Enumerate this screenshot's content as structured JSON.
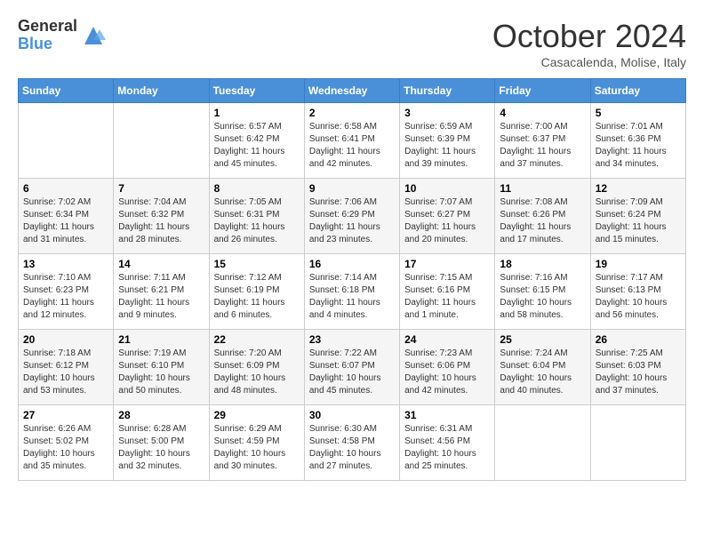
{
  "logo": {
    "general": "General",
    "blue": "Blue"
  },
  "title": "October 2024",
  "subtitle": "Casacalenda, Molise, Italy",
  "days_header": [
    "Sunday",
    "Monday",
    "Tuesday",
    "Wednesday",
    "Thursday",
    "Friday",
    "Saturday"
  ],
  "weeks": [
    [
      {
        "day": "",
        "sunrise": "",
        "sunset": "",
        "daylight": ""
      },
      {
        "day": "",
        "sunrise": "",
        "sunset": "",
        "daylight": ""
      },
      {
        "day": "1",
        "sunrise": "Sunrise: 6:57 AM",
        "sunset": "Sunset: 6:42 PM",
        "daylight": "Daylight: 11 hours and 45 minutes."
      },
      {
        "day": "2",
        "sunrise": "Sunrise: 6:58 AM",
        "sunset": "Sunset: 6:41 PM",
        "daylight": "Daylight: 11 hours and 42 minutes."
      },
      {
        "day": "3",
        "sunrise": "Sunrise: 6:59 AM",
        "sunset": "Sunset: 6:39 PM",
        "daylight": "Daylight: 11 hours and 39 minutes."
      },
      {
        "day": "4",
        "sunrise": "Sunrise: 7:00 AM",
        "sunset": "Sunset: 6:37 PM",
        "daylight": "Daylight: 11 hours and 37 minutes."
      },
      {
        "day": "5",
        "sunrise": "Sunrise: 7:01 AM",
        "sunset": "Sunset: 6:36 PM",
        "daylight": "Daylight: 11 hours and 34 minutes."
      }
    ],
    [
      {
        "day": "6",
        "sunrise": "Sunrise: 7:02 AM",
        "sunset": "Sunset: 6:34 PM",
        "daylight": "Daylight: 11 hours and 31 minutes."
      },
      {
        "day": "7",
        "sunrise": "Sunrise: 7:04 AM",
        "sunset": "Sunset: 6:32 PM",
        "daylight": "Daylight: 11 hours and 28 minutes."
      },
      {
        "day": "8",
        "sunrise": "Sunrise: 7:05 AM",
        "sunset": "Sunset: 6:31 PM",
        "daylight": "Daylight: 11 hours and 26 minutes."
      },
      {
        "day": "9",
        "sunrise": "Sunrise: 7:06 AM",
        "sunset": "Sunset: 6:29 PM",
        "daylight": "Daylight: 11 hours and 23 minutes."
      },
      {
        "day": "10",
        "sunrise": "Sunrise: 7:07 AM",
        "sunset": "Sunset: 6:27 PM",
        "daylight": "Daylight: 11 hours and 20 minutes."
      },
      {
        "day": "11",
        "sunrise": "Sunrise: 7:08 AM",
        "sunset": "Sunset: 6:26 PM",
        "daylight": "Daylight: 11 hours and 17 minutes."
      },
      {
        "day": "12",
        "sunrise": "Sunrise: 7:09 AM",
        "sunset": "Sunset: 6:24 PM",
        "daylight": "Daylight: 11 hours and 15 minutes."
      }
    ],
    [
      {
        "day": "13",
        "sunrise": "Sunrise: 7:10 AM",
        "sunset": "Sunset: 6:23 PM",
        "daylight": "Daylight: 11 hours and 12 minutes."
      },
      {
        "day": "14",
        "sunrise": "Sunrise: 7:11 AM",
        "sunset": "Sunset: 6:21 PM",
        "daylight": "Daylight: 11 hours and 9 minutes."
      },
      {
        "day": "15",
        "sunrise": "Sunrise: 7:12 AM",
        "sunset": "Sunset: 6:19 PM",
        "daylight": "Daylight: 11 hours and 6 minutes."
      },
      {
        "day": "16",
        "sunrise": "Sunrise: 7:14 AM",
        "sunset": "Sunset: 6:18 PM",
        "daylight": "Daylight: 11 hours and 4 minutes."
      },
      {
        "day": "17",
        "sunrise": "Sunrise: 7:15 AM",
        "sunset": "Sunset: 6:16 PM",
        "daylight": "Daylight: 11 hours and 1 minute."
      },
      {
        "day": "18",
        "sunrise": "Sunrise: 7:16 AM",
        "sunset": "Sunset: 6:15 PM",
        "daylight": "Daylight: 10 hours and 58 minutes."
      },
      {
        "day": "19",
        "sunrise": "Sunrise: 7:17 AM",
        "sunset": "Sunset: 6:13 PM",
        "daylight": "Daylight: 10 hours and 56 minutes."
      }
    ],
    [
      {
        "day": "20",
        "sunrise": "Sunrise: 7:18 AM",
        "sunset": "Sunset: 6:12 PM",
        "daylight": "Daylight: 10 hours and 53 minutes."
      },
      {
        "day": "21",
        "sunrise": "Sunrise: 7:19 AM",
        "sunset": "Sunset: 6:10 PM",
        "daylight": "Daylight: 10 hours and 50 minutes."
      },
      {
        "day": "22",
        "sunrise": "Sunrise: 7:20 AM",
        "sunset": "Sunset: 6:09 PM",
        "daylight": "Daylight: 10 hours and 48 minutes."
      },
      {
        "day": "23",
        "sunrise": "Sunrise: 7:22 AM",
        "sunset": "Sunset: 6:07 PM",
        "daylight": "Daylight: 10 hours and 45 minutes."
      },
      {
        "day": "24",
        "sunrise": "Sunrise: 7:23 AM",
        "sunset": "Sunset: 6:06 PM",
        "daylight": "Daylight: 10 hours and 42 minutes."
      },
      {
        "day": "25",
        "sunrise": "Sunrise: 7:24 AM",
        "sunset": "Sunset: 6:04 PM",
        "daylight": "Daylight: 10 hours and 40 minutes."
      },
      {
        "day": "26",
        "sunrise": "Sunrise: 7:25 AM",
        "sunset": "Sunset: 6:03 PM",
        "daylight": "Daylight: 10 hours and 37 minutes."
      }
    ],
    [
      {
        "day": "27",
        "sunrise": "Sunrise: 6:26 AM",
        "sunset": "Sunset: 5:02 PM",
        "daylight": "Daylight: 10 hours and 35 minutes."
      },
      {
        "day": "28",
        "sunrise": "Sunrise: 6:28 AM",
        "sunset": "Sunset: 5:00 PM",
        "daylight": "Daylight: 10 hours and 32 minutes."
      },
      {
        "day": "29",
        "sunrise": "Sunrise: 6:29 AM",
        "sunset": "Sunset: 4:59 PM",
        "daylight": "Daylight: 10 hours and 30 minutes."
      },
      {
        "day": "30",
        "sunrise": "Sunrise: 6:30 AM",
        "sunset": "Sunset: 4:58 PM",
        "daylight": "Daylight: 10 hours and 27 minutes."
      },
      {
        "day": "31",
        "sunrise": "Sunrise: 6:31 AM",
        "sunset": "Sunset: 4:56 PM",
        "daylight": "Daylight: 10 hours and 25 minutes."
      },
      {
        "day": "",
        "sunrise": "",
        "sunset": "",
        "daylight": ""
      },
      {
        "day": "",
        "sunrise": "",
        "sunset": "",
        "daylight": ""
      }
    ]
  ]
}
